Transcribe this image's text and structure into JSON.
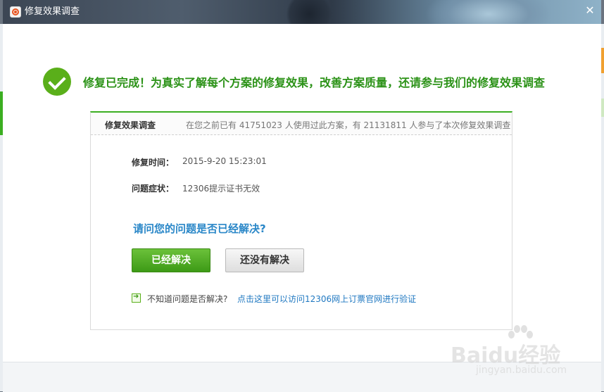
{
  "window": {
    "title": "修复效果调查",
    "close_label": "✕"
  },
  "headline": "修复已完成！为真实了解每个方案的修复效果，改善方案质量，还请参与我们的修复效果调查",
  "card": {
    "title": "修复效果调查",
    "stats": "在您之前已有 41751023 人使用过此方案，有 21131811 人参与了本次修复效果调查",
    "repair_time_label": "修复时间：",
    "repair_time_value": "2015-9-20 15:23:01",
    "symptom_label": "问题症状：",
    "symptom_value": "12306提示证书无效",
    "question": "请问您的问题是否已经解决?",
    "yes_button": "已经解决",
    "no_button": "还没有解决",
    "help_text": "不知道问题是否解决?",
    "help_link": "点击这里可以访问12306网上订票官网进行验证"
  },
  "watermark": {
    "brand": "Baidu经验",
    "sub": "jingyan.baidu.com"
  },
  "colors": {
    "accent_green": "#3bae21",
    "headline_green": "#2b9217",
    "question_blue": "#2a87c8",
    "link_blue": "#1f78c1"
  },
  "icons": [
    "app-logo-icon",
    "close-icon",
    "success-check-icon",
    "arrow-right-icon"
  ]
}
